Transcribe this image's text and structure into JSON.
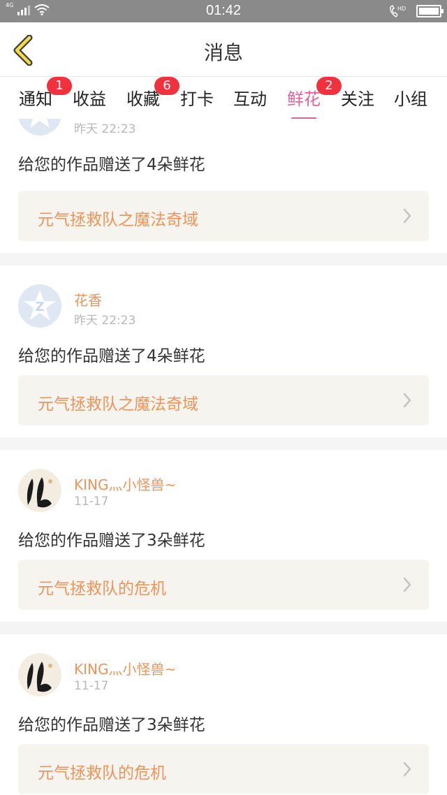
{
  "status_bar": {
    "network": "4G",
    "time": "01:42",
    "hd": "HD"
  },
  "header": {
    "title": "消息"
  },
  "tabs": [
    {
      "label": "通知",
      "badge": "1",
      "active": false
    },
    {
      "label": "收益",
      "badge": "",
      "active": false
    },
    {
      "label": "收藏",
      "badge": "6",
      "active": false
    },
    {
      "label": "打卡",
      "badge": "",
      "active": false
    },
    {
      "label": "互动",
      "badge": "",
      "active": false
    },
    {
      "label": "鲜花",
      "badge": "2",
      "active": true
    },
    {
      "label": "关注",
      "badge": "",
      "active": false
    },
    {
      "label": "小组",
      "badge": "",
      "active": false
    }
  ],
  "messages": [
    {
      "user": "",
      "time": "昨天 22:23",
      "text": "给您的作品赠送了4朵鲜花",
      "work": "元气拯救队之魔法奇域",
      "avatar": "default-avatar"
    },
    {
      "user": "花香",
      "time": "昨天 22:23",
      "text": "给您的作品赠送了4朵鲜花",
      "work": "元气拯救队之魔法奇域",
      "avatar": "default-avatar"
    },
    {
      "user": "KING灬小怪兽~",
      "time": "11-17",
      "text": "给您的作品赠送了3朵鲜花",
      "work": "元气拯救队的危机",
      "avatar": "photo-avatar"
    },
    {
      "user": "KING灬小怪兽~",
      "time": "11-17",
      "text": "给您的作品赠送了3朵鲜花",
      "work": "元气拯救队的危机",
      "avatar": "photo-avatar"
    }
  ],
  "colors": {
    "accent": "#e4609a",
    "badge": "#f2313f",
    "username": "#f0935a",
    "work_bg": "#f5f4ee"
  }
}
